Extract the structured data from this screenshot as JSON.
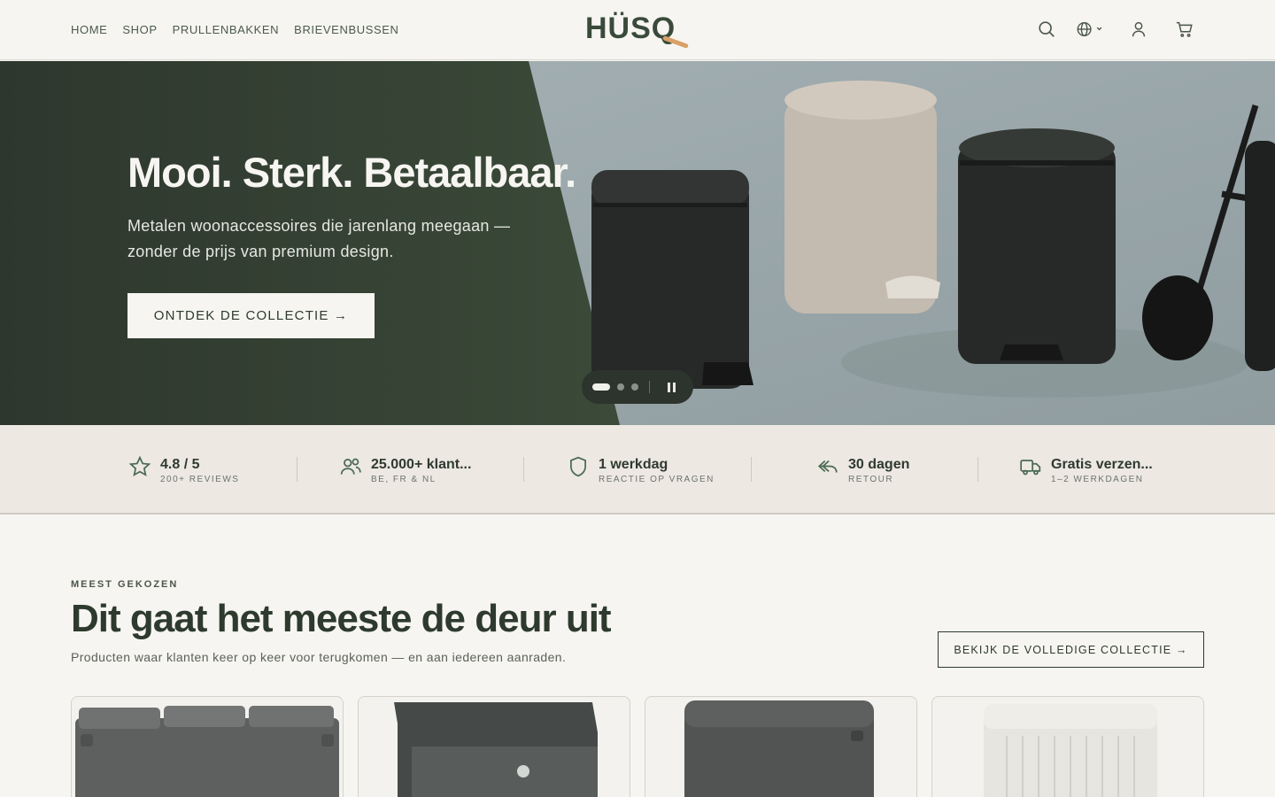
{
  "header": {
    "nav": [
      "HOME",
      "SHOP",
      "PRULLENBAKKEN",
      "BRIEVENBUSSEN"
    ],
    "logo": "HÜSQ",
    "icons": [
      "search-icon",
      "globe-icon",
      "account-icon",
      "cart-icon"
    ]
  },
  "hero": {
    "title": "Mooi. Sterk. Betaalbaar.",
    "subtitle": "Metalen woonaccessoires die jarenlang meegaan — zonder de prijs van premium design.",
    "cta": "ONTDEK DE COLLECTIE →",
    "slides": 3,
    "active_slide": 1
  },
  "trust": [
    {
      "icon": "star-icon",
      "title": "4.8 / 5",
      "sub": "200+ REVIEWS"
    },
    {
      "icon": "users-icon",
      "title": "25.000+ klant...",
      "sub": "BE, FR & NL"
    },
    {
      "icon": "shield-icon",
      "title": "1 werkdag",
      "sub": "REACTIE OP VRAGEN"
    },
    {
      "icon": "return-icon",
      "title": "30 dagen",
      "sub": "RETOUR"
    },
    {
      "icon": "truck-icon",
      "title": "Gratis verzen...",
      "sub": "1–2 WERKDAGEN"
    }
  ],
  "bestsellers": {
    "eyebrow": "MEEST GEKOZEN",
    "title": "Dit gaat het meeste de deur uit",
    "subtitle": "Producten waar klanten keer op keer voor terugkomen — en aan iedereen aanraden.",
    "button": "BEKIJK DE VOLLEDIGE COLLECTIE →"
  },
  "colors": {
    "accent_green": "#333d32",
    "cream": "#f6f5f1",
    "logo_orange": "#d9a067",
    "trust_bg": "#ede8e2"
  }
}
